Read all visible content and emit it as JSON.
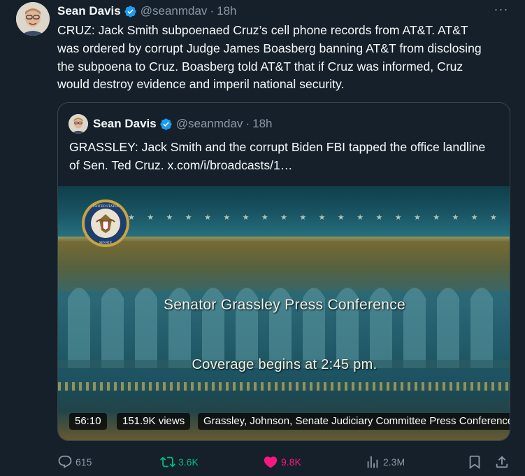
{
  "tweet": {
    "author_name": "Sean Davis",
    "handle": "@seanmdav",
    "dot": "·",
    "time": "18h",
    "more": "···",
    "text": "CRUZ: Jack Smith subpoenaed Cruz’s cell phone records from AT&T. AT&T was ordered by corrupt Judge James Boasberg banning AT&T from disclosing the subpoena to Cruz. Boasberg told AT&T that if Cruz was informed, Cruz would destroy evidence and imperil national security."
  },
  "quote": {
    "author_name": "Sean Davis",
    "handle": "@seanmdav",
    "dot": "·",
    "time": "18h",
    "text": "GRASSLEY: Jack Smith and the corrupt Biden FBI tapped the office landline of Sen. Ted Cruz. x.com/i/broadcasts/1…",
    "media": {
      "title": "Senator Grassley Press Conference",
      "coverage": "Coverage begins at 2:45 pm.",
      "seal_text": "UNITED STATES SENATE",
      "duration": "56:10",
      "views": "151.9K views",
      "broadcast_title": "Grassley, Johnson, Senate Judiciary Committee Press Conference"
    }
  },
  "actions": {
    "replies": "615",
    "retweets": "3.6K",
    "likes": "9.8K",
    "views": "2.3M"
  },
  "colors": {
    "background": "#15202b",
    "retweet_green": "#00ba7c",
    "like_pink": "#f91880",
    "verified_blue": "#1d9bf0",
    "muted": "#8b98a5"
  },
  "icons": [
    "verified-badge-icon",
    "more-icon",
    "reply-icon",
    "retweet-icon",
    "heart-icon",
    "views-icon",
    "bookmark-icon",
    "share-icon"
  ]
}
